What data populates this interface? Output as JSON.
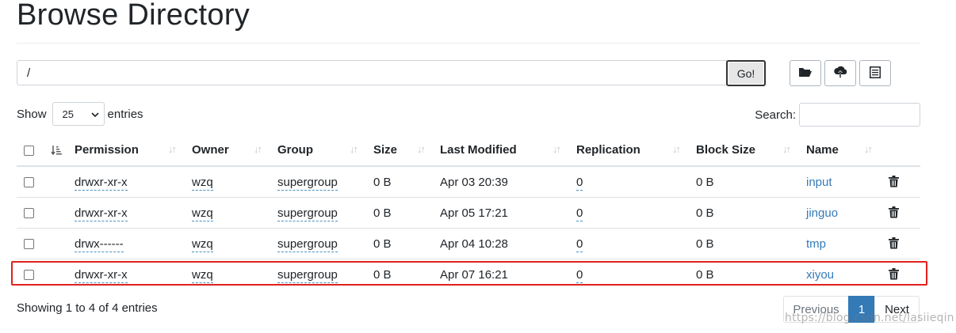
{
  "page_title": "Browse Directory",
  "path": {
    "value": "/"
  },
  "go_label": "Go!",
  "show": {
    "prefix": "Show",
    "selected": "25",
    "suffix": "entries"
  },
  "search": {
    "label": "Search:",
    "value": ""
  },
  "columns": [
    "Permission",
    "Owner",
    "Group",
    "Size",
    "Last Modified",
    "Replication",
    "Block Size",
    "Name"
  ],
  "rows": [
    {
      "permission": "drwxr-xr-x",
      "owner": "wzq",
      "group": "supergroup",
      "size": "0 B",
      "modified": "Apr 03 20:39",
      "replication": "0",
      "block_size": "0 B",
      "name": "input"
    },
    {
      "permission": "drwxr-xr-x",
      "owner": "wzq",
      "group": "supergroup",
      "size": "0 B",
      "modified": "Apr 05 17:21",
      "replication": "0",
      "block_size": "0 B",
      "name": "jinguo"
    },
    {
      "permission": "drwx------",
      "owner": "wzq",
      "group": "supergroup",
      "size": "0 B",
      "modified": "Apr 04 10:28",
      "replication": "0",
      "block_size": "0 B",
      "name": "tmp"
    },
    {
      "permission": "drwxr-xr-x",
      "owner": "wzq",
      "group": "supergroup",
      "size": "0 B",
      "modified": "Apr 07 16:21",
      "replication": "0",
      "block_size": "0 B",
      "name": "xiyou"
    }
  ],
  "footer": {
    "info": "Showing 1 to 4 of 4 entries",
    "previous": "Previous",
    "current_page": "1",
    "next": "Next"
  },
  "watermark": "https://blog.csdn.net/lasiieqin",
  "colors": {
    "link": "#337ab7",
    "highlight": "#e0201b",
    "active_page": "#337ab7"
  },
  "icons": [
    "folder-open-icon",
    "upload-icon",
    "list-icon",
    "sort-icon",
    "trash-icon",
    "chevron-down-icon"
  ]
}
